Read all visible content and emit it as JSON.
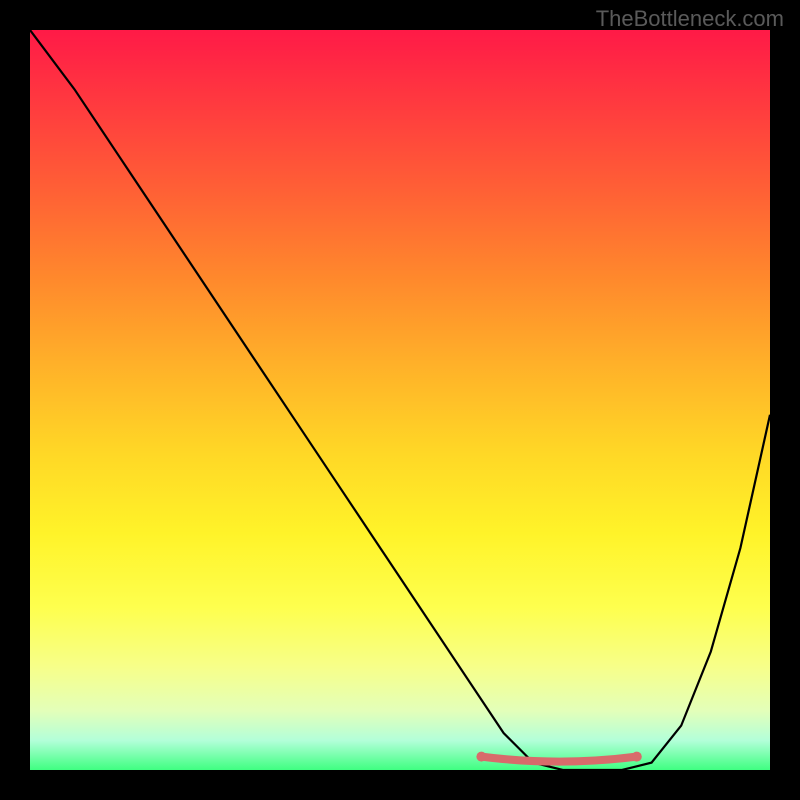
{
  "attribution": "TheBottleneck.com",
  "chart_data": {
    "type": "line",
    "title": "",
    "xlabel": "",
    "ylabel": "",
    "xlim": [
      0,
      100
    ],
    "ylim": [
      0,
      100
    ],
    "series": [
      {
        "name": "bottleneck-curve",
        "x": [
          0,
          6,
          12,
          18,
          24,
          30,
          36,
          42,
          48,
          54,
          60,
          64,
          68,
          72,
          76,
          80,
          84,
          88,
          92,
          96,
          100
        ],
        "y": [
          100,
          92,
          83,
          74,
          65,
          56,
          47,
          38,
          29,
          20,
          11,
          5,
          1,
          0,
          0,
          0,
          1,
          6,
          16,
          30,
          48
        ]
      }
    ],
    "highlight": {
      "name": "flat-region",
      "x_range": [
        61,
        82
      ],
      "y": 1,
      "color": "#d86b6b"
    },
    "background": {
      "type": "vertical-gradient",
      "top_color": "#ff1a47",
      "mid_color": "#ffd726",
      "bottom_color": "#3fff81"
    }
  }
}
